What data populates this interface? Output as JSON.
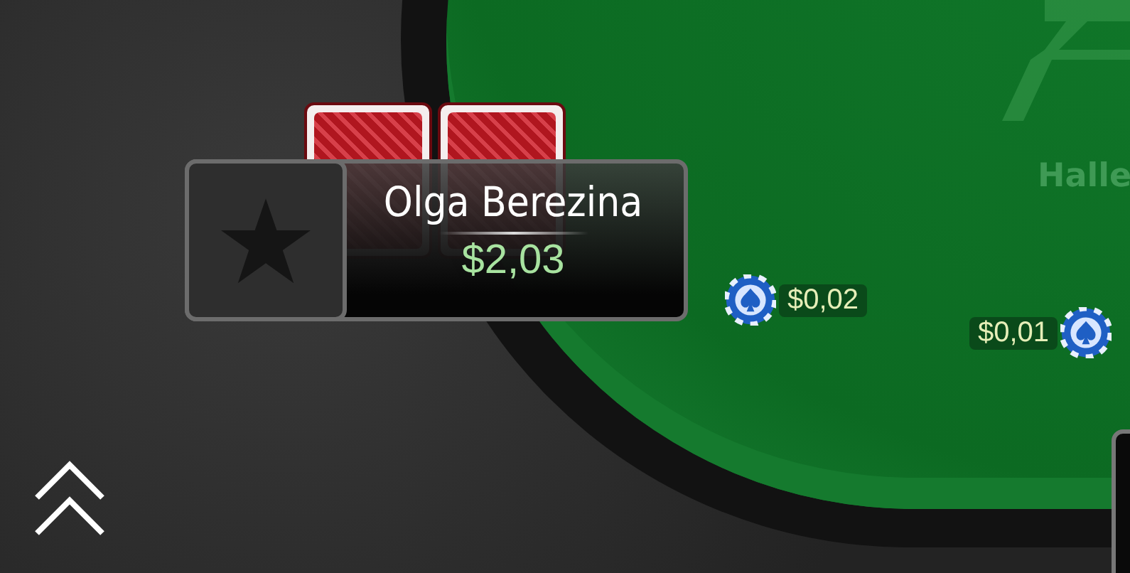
{
  "table": {
    "label": "Halle"
  },
  "player": {
    "name": "Olga Berezina",
    "stack": "$2,03"
  },
  "bets": [
    {
      "amount": "$0,02",
      "kind": "chipfirst"
    },
    {
      "amount": "$0,01",
      "kind": "chiplast"
    }
  ]
}
